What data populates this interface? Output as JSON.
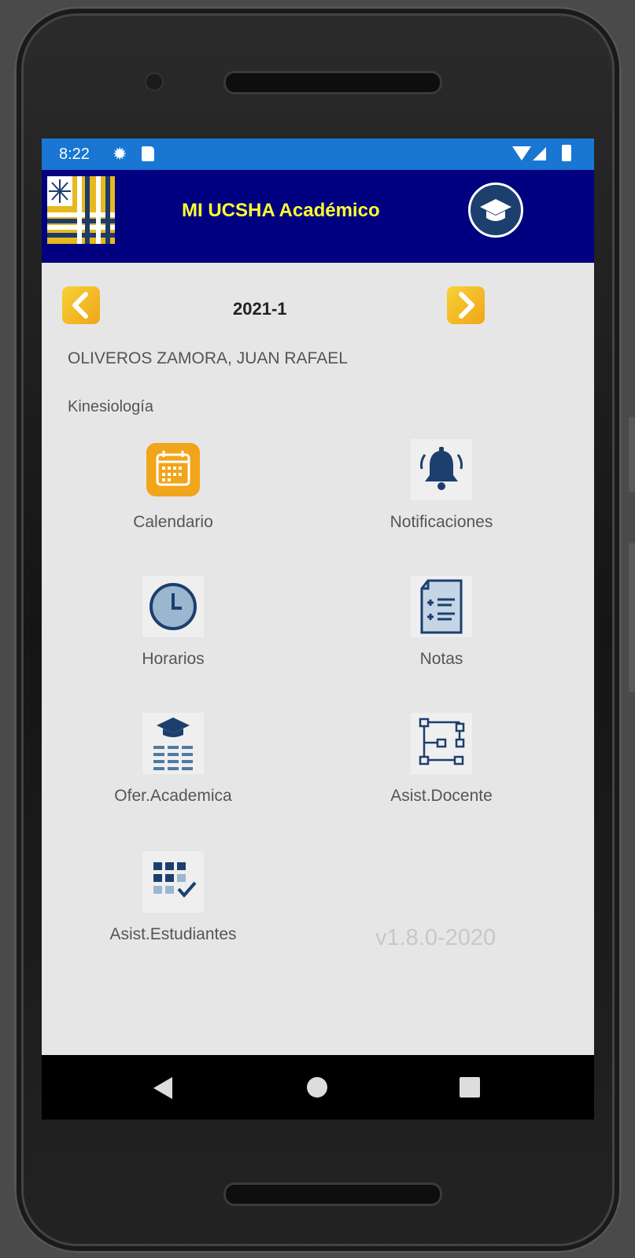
{
  "status_bar": {
    "time": "8:22"
  },
  "app_bar": {
    "title": "MI UCSHA Académico"
  },
  "period": {
    "value": "2021-1"
  },
  "student": {
    "name": "OLIVEROS  ZAMORA, JUAN RAFAEL",
    "career": "Kinesiología"
  },
  "menu": [
    {
      "label": "Calendario",
      "icon": "calendar-icon"
    },
    {
      "label": "Notificaciones",
      "icon": "bell-icon"
    },
    {
      "label": "Horarios",
      "icon": "clock-icon"
    },
    {
      "label": "Notas",
      "icon": "grades-document-icon"
    },
    {
      "label": "Ofer.Academica",
      "icon": "academic-offer-icon"
    },
    {
      "label": "Asist.Docente",
      "icon": "workflow-icon"
    },
    {
      "label": "Asist.Estudiantes",
      "icon": "attendance-grid-icon"
    }
  ],
  "version": "v1.8.0-2020",
  "colors": {
    "status_bar": "#1976d2",
    "app_bar": "#000080",
    "title": "#ffff33",
    "accent_orange": "#f0a51a",
    "icon_blue": "#1c3f6e"
  }
}
